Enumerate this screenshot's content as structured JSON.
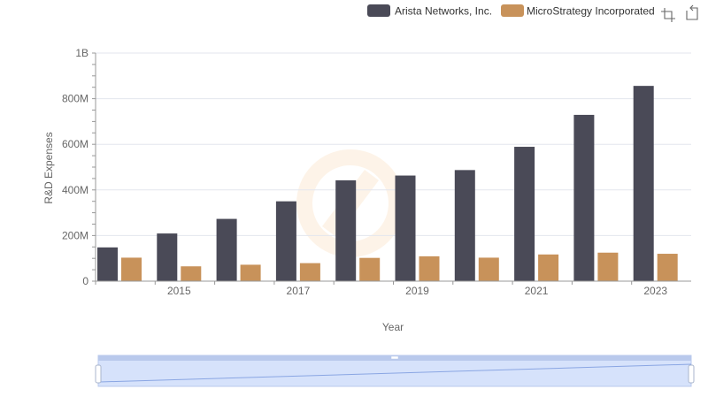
{
  "chart_data": {
    "type": "bar",
    "categories": [
      "2014",
      "2015",
      "2016",
      "2017",
      "2018",
      "2019",
      "2020",
      "2021",
      "2022",
      "2023"
    ],
    "series": [
      {
        "name": "Arista Networks, Inc.",
        "color": "#4a4a57",
        "values": [
          148000000,
          209000000,
          273000000,
          350000000,
          442000000,
          463000000,
          487000000,
          589000000,
          729000000,
          856000000
        ]
      },
      {
        "name": "MicroStrategy Incorporated",
        "color": "#c8925a",
        "values": [
          103000000,
          65000000,
          72000000,
          79000000,
          102000000,
          109000000,
          103000000,
          117000000,
          125000000,
          120000000
        ]
      }
    ],
    "x_tick_labels": [
      "2015",
      "2017",
      "2019",
      "2021",
      "2023"
    ],
    "y_ticks": [
      0,
      200000000,
      400000000,
      600000000,
      800000000,
      1000000000
    ],
    "y_tick_labels": [
      "0",
      "200M",
      "400M",
      "600M",
      "800M",
      "1B"
    ],
    "ylim": [
      0,
      1000000000
    ],
    "xlabel": "Year",
    "ylabel": "R&D Expenses",
    "grid": true,
    "legend_position": "top-right"
  },
  "toolbar": {
    "zoom_icon": "zoom-select-icon",
    "reset_icon": "zoom-reset-icon"
  },
  "colors": {
    "grid": "#e3e6ee",
    "slider_fill": "#d6e2fb",
    "slider_border": "#b9c9ec",
    "slider_line": "#8aa6e3"
  }
}
